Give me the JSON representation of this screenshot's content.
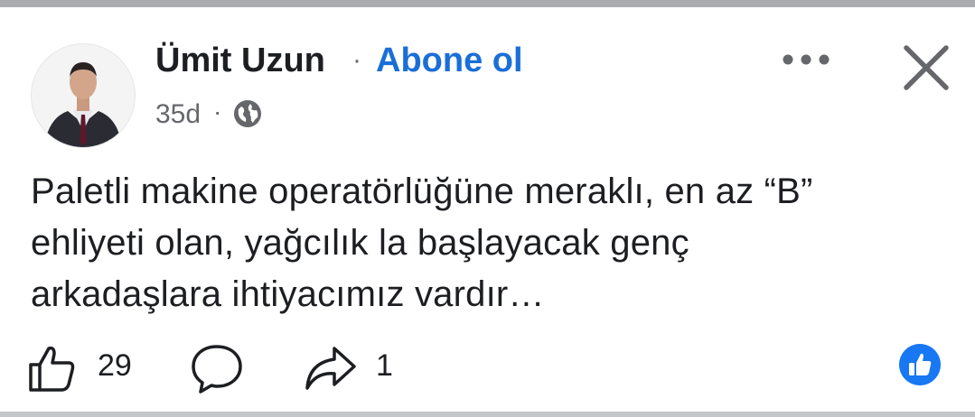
{
  "post": {
    "author": "Ümit Uzun",
    "separator": "·",
    "follow_label": "Abone ol",
    "time": "35d",
    "meta_separator": "·",
    "privacy_icon": "globe-icon",
    "text_lines": [
      "Paletli makine operatörlüğüne meraklı, en az “B”",
      "ehliyeti olan, yağcılık la başlayacak genç",
      "arkadaşlara ihtiyacımız vardır…"
    ]
  },
  "actions": {
    "like_count": "29",
    "share_count": "1",
    "like_icon": "thumbs-up-icon",
    "comment_icon": "comment-bubble-icon",
    "share_icon": "share-arrow-icon",
    "reaction_icon": "like-reaction-icon"
  },
  "header_icons": {
    "more": "more-options-icon",
    "close": "close-icon"
  },
  "colors": {
    "link_blue": "#1a6ed8",
    "reaction_blue": "#1877f2",
    "muted_text": "#65676b",
    "text": "#1c1e21"
  }
}
